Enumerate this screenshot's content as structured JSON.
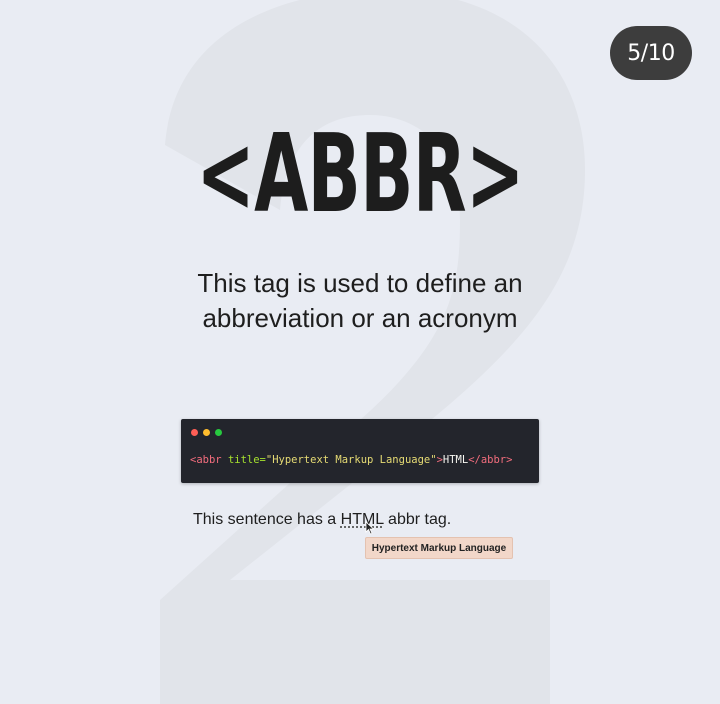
{
  "slide": {
    "counter": "5/10"
  },
  "header": {
    "title": "<ABBR>",
    "description_line1": "This tag is used to define an",
    "description_line2": "abbreviation or an acronym"
  },
  "code_snippet": {
    "tag_open_start": "<abbr ",
    "attr_name": "title=",
    "attr_value": "\"Hypertext Markup Language\"",
    "tag_open_end": ">",
    "content": "HTML",
    "tag_close": "</abbr>"
  },
  "demo": {
    "sentence_before": "This sentence has a ",
    "abbr_text": "HTML",
    "sentence_after": " abbr tag.",
    "tooltip": "Hypertext Markup Language"
  },
  "colors": {
    "background": "#e9ecf3",
    "badge": "#3d3d3d",
    "code_background": "#23252c",
    "tooltip_background": "#f2d7c9"
  }
}
